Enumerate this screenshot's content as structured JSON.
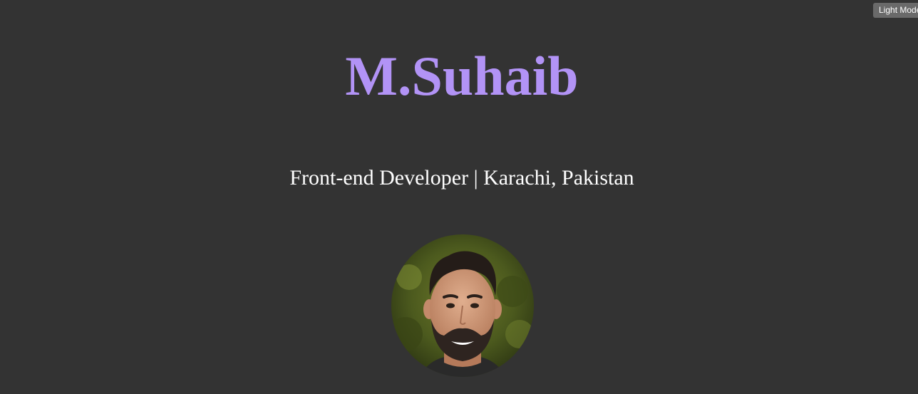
{
  "theme_toggle": {
    "label": "Light Mode"
  },
  "profile": {
    "name": "M.Suhaib",
    "tagline": "Front-end Developer | Karachi, Pakistan",
    "avatar_icon": "profile-photo"
  },
  "colors": {
    "background": "#333333",
    "name_accent": "#b293f6",
    "tagline_text": "#ffffff",
    "toggle_background": "#6a6a6a"
  }
}
